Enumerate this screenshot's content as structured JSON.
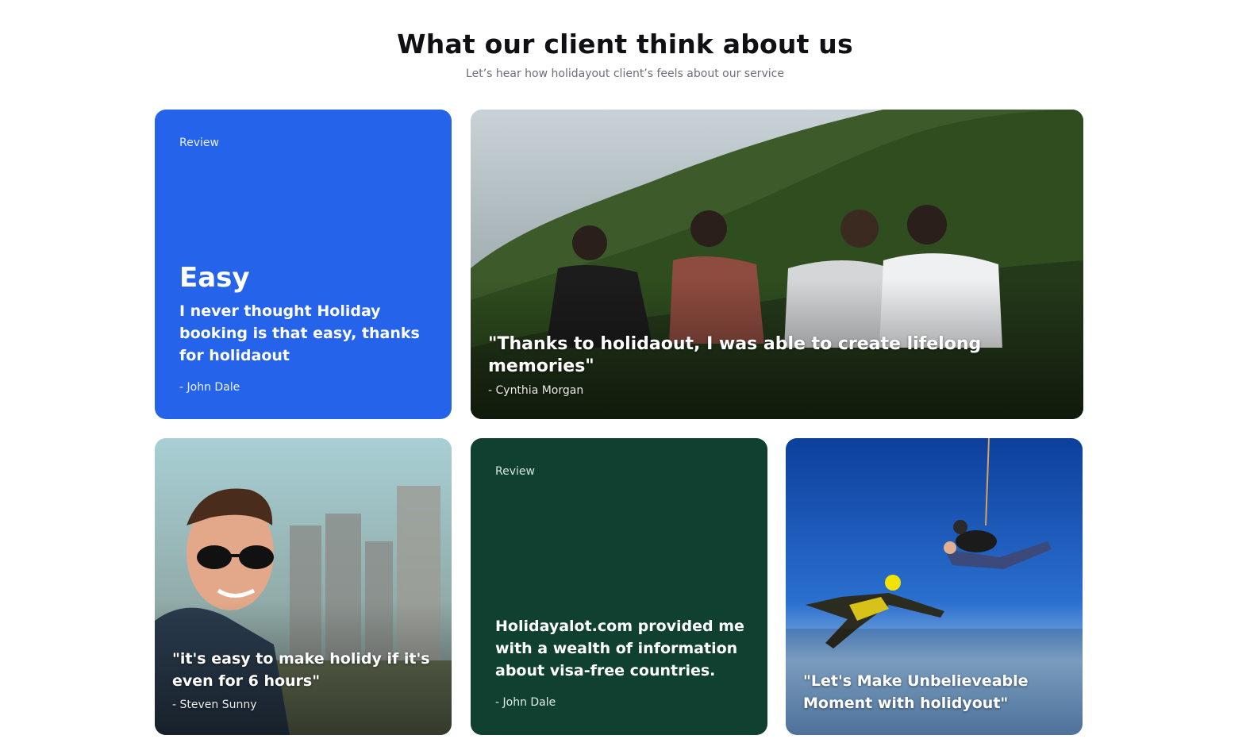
{
  "header": {
    "title": "What our client think about us",
    "subtitle": "Let’s hear how holidayout client’s feels about our service"
  },
  "cards": [
    {
      "tag": "Review",
      "headline": "Easy",
      "quote": "I never thought Holiday booking is that easy, thanks for holidaout",
      "author": "- John Dale",
      "background": "#2563eb"
    },
    {
      "quote": "\"Thanks to holidaout, I was able to create lifelong memories\"",
      "author": "- Cynthia Morgan",
      "image": "hikers-on-green-mountain"
    },
    {
      "quote": "\"it's easy to make holidy if it's even for 6 hours\"",
      "author": "- Steven Sunny",
      "image": "man-with-sunglasses-city"
    },
    {
      "tag": "Review",
      "quote": "Holidayalot.com provided me with a wealth of information about visa-free countries.",
      "author": "- John Dale",
      "background": "#0f4030"
    },
    {
      "quote": "\"Let's Make Unbelieveable Moment with holidyout\"",
      "image": "skydivers-blue-sky"
    }
  ]
}
